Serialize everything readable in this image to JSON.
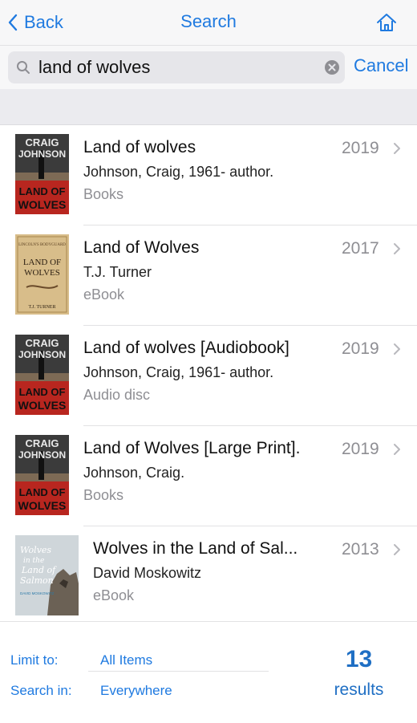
{
  "nav": {
    "back_label": "Back",
    "title": "Search",
    "home_icon": "home-icon"
  },
  "search": {
    "value": "land of wolves",
    "placeholder": "",
    "cancel_label": "Cancel"
  },
  "colors": {
    "accent": "#1f7ae0",
    "secondary_text": "#8e8e93",
    "separator": "#e2e2e4"
  },
  "results": [
    {
      "title": "Land of wolves",
      "author": "Johnson, Craig, 1961- author.",
      "format": "Books",
      "year": "2019",
      "cover": {
        "line1": "CRAIG",
        "line2": "JOHNSON",
        "line3": "LAND OF",
        "line4": "WOLVES"
      }
    },
    {
      "title": "Land of Wolves",
      "author": "T.J. Turner",
      "format": "eBook",
      "year": "2017",
      "cover": {
        "top": "LINCOLN'S BODYGUARD",
        "line1": "LAND OF",
        "line2": "WOLVES",
        "bottom": "T.J. TURNER"
      }
    },
    {
      "title": "Land of wolves [Audiobook]",
      "author": "Johnson, Craig, 1961- author.",
      "format": "Audio disc",
      "year": "2019",
      "cover": {
        "line1": "CRAIG",
        "line2": "JOHNSON",
        "line3": "LAND OF",
        "line4": "WOLVES"
      }
    },
    {
      "title": "Land of Wolves [Large Print].",
      "author": "Johnson, Craig.",
      "format": "Books",
      "year": "2019",
      "cover": {
        "line1": "CRAIG",
        "line2": "JOHNSON",
        "line3": "LAND OF",
        "line4": "WOLVES"
      }
    },
    {
      "title": "Wolves in the Land of Sal...",
      "author": "David Moskowitz",
      "format": "eBook",
      "year": "2013",
      "cover": {
        "line1": "Wolves",
        "line2": "in the",
        "line3": "Land of",
        "line4": "Salmon",
        "bottom": "DAVID MOSKOWITZ"
      }
    }
  ],
  "footer": {
    "limit_label": "Limit to:",
    "limit_value": "All Items",
    "searchin_label": "Search in:",
    "searchin_value": "Everywhere",
    "count": "13",
    "count_label": "results"
  }
}
